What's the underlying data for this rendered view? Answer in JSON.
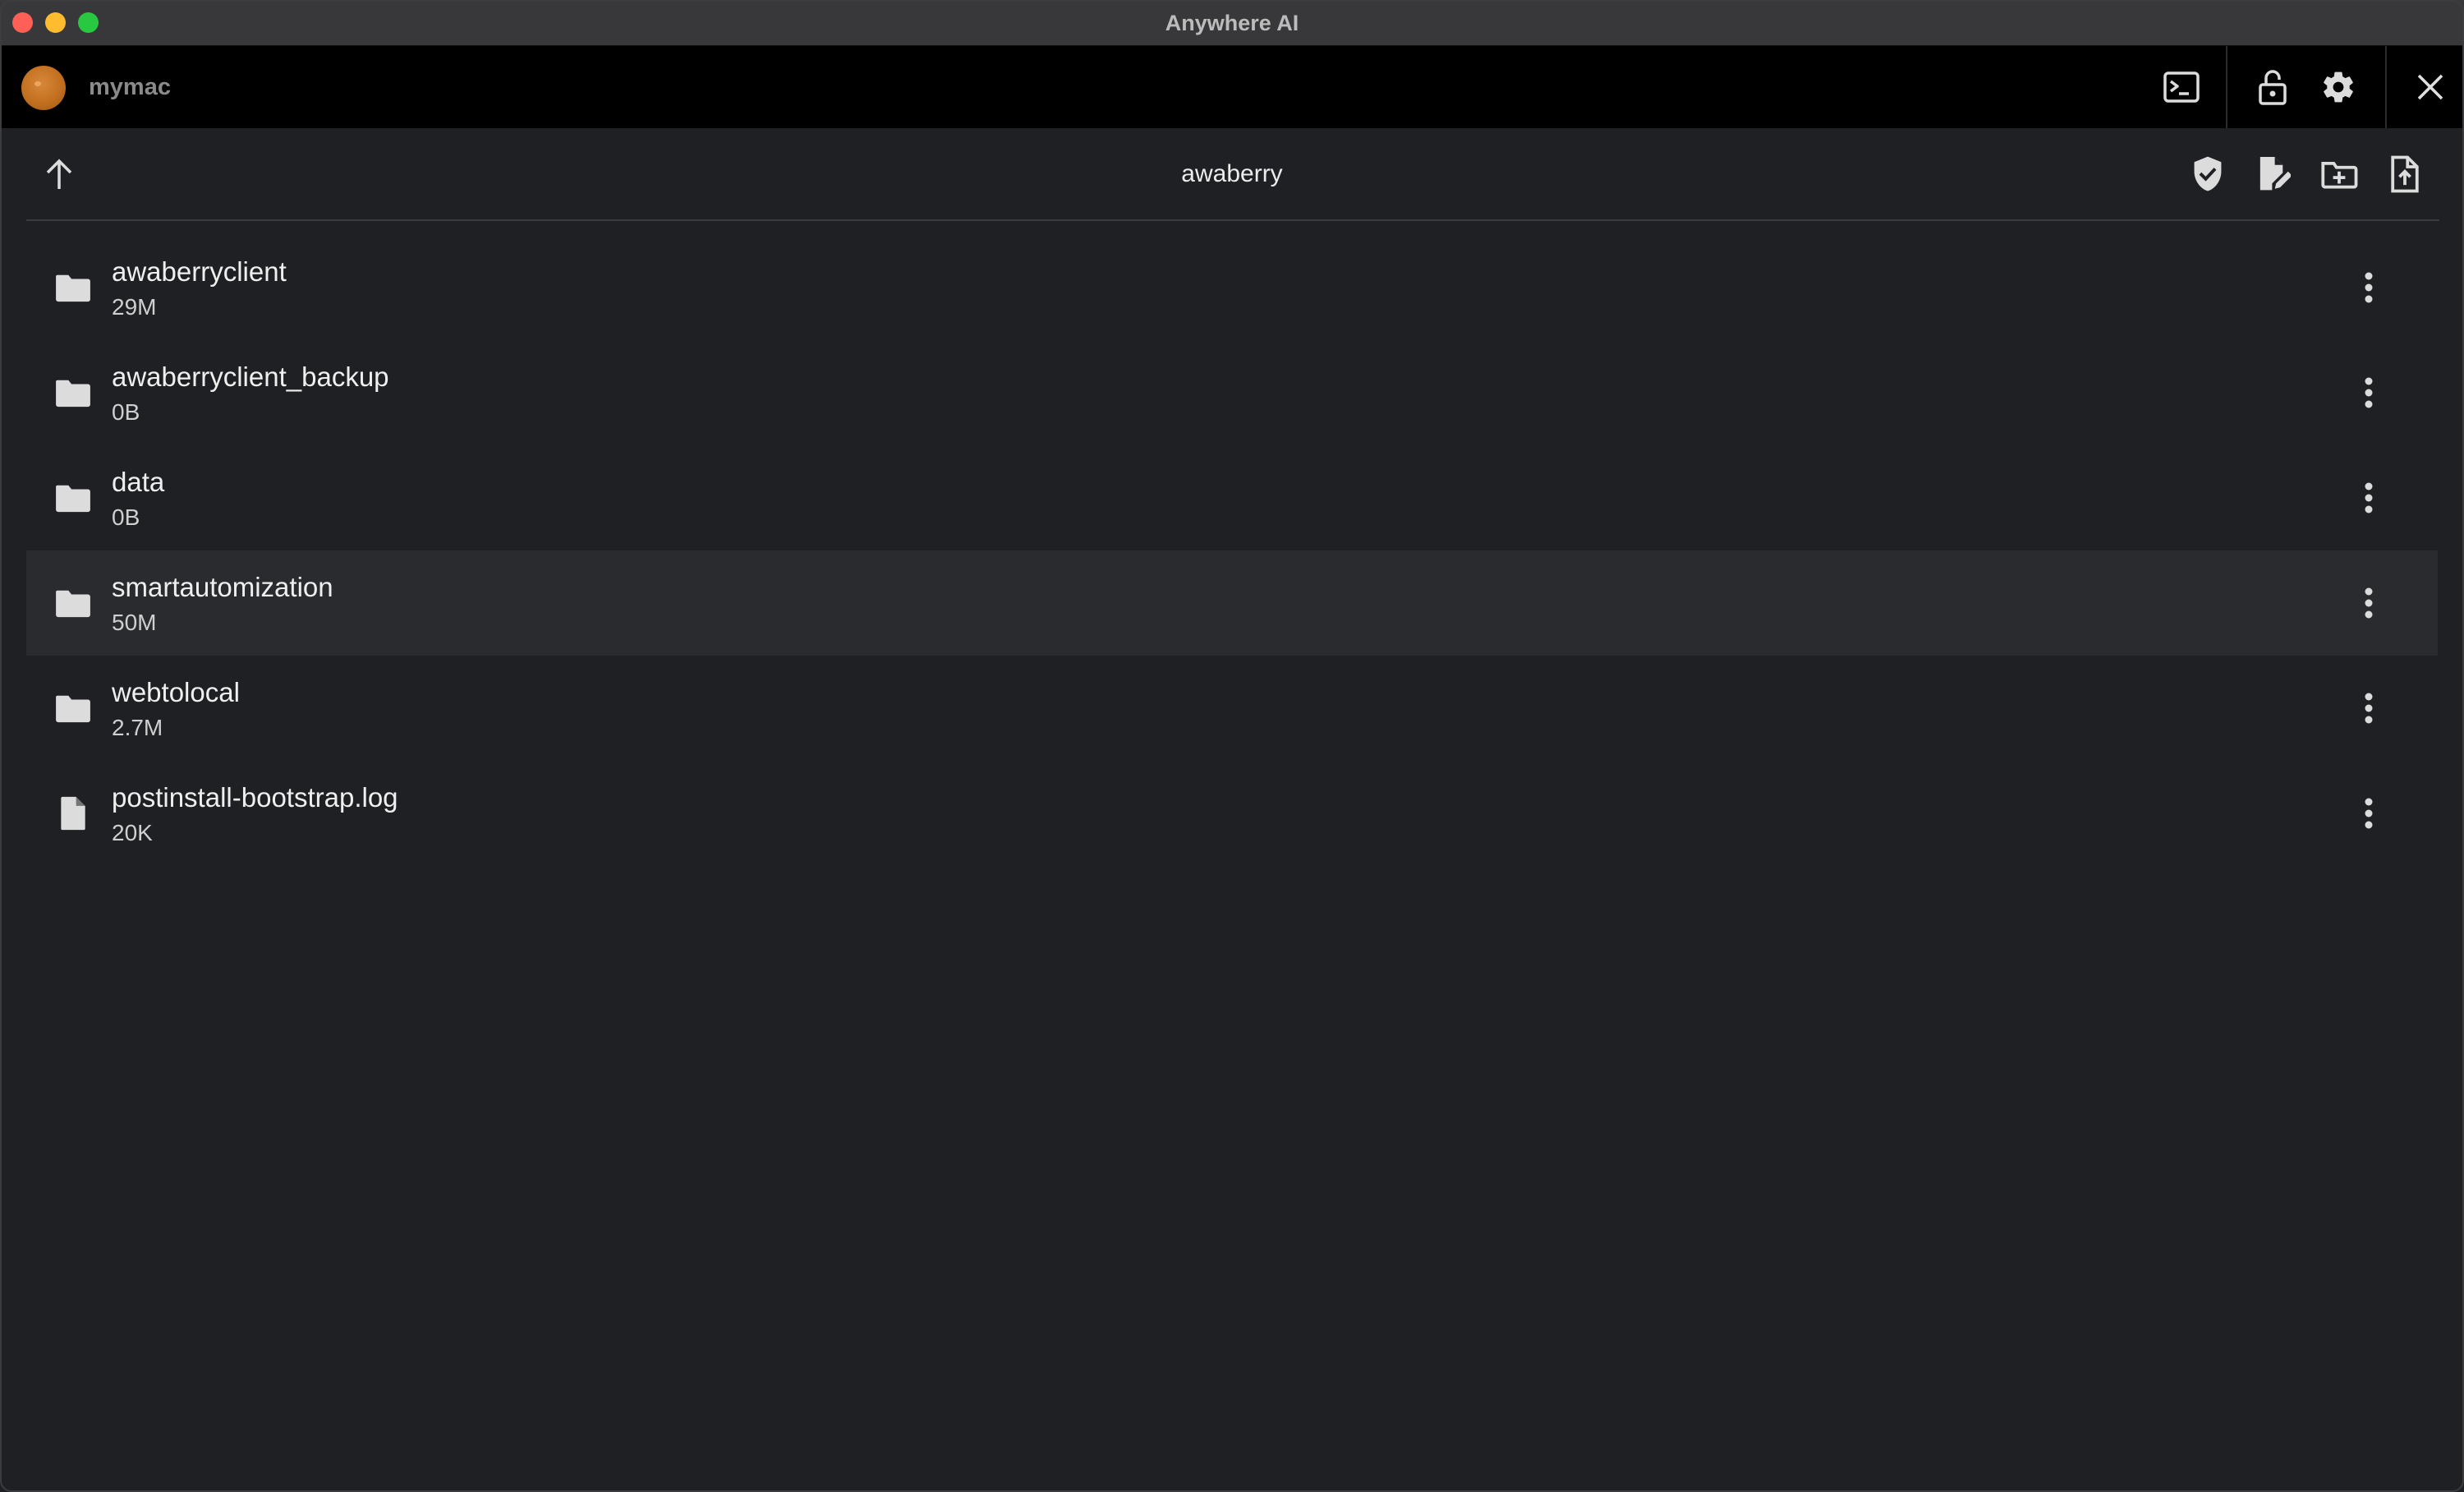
{
  "window": {
    "title": "Anywhere AI"
  },
  "header": {
    "host_name": "mymac",
    "icons": {
      "terminal": "terminal-icon",
      "lock": "lock-open-icon",
      "settings": "gear-icon",
      "close": "close-icon"
    }
  },
  "toolbar": {
    "folder_title": "awaberry",
    "icons": {
      "up": "arrow-up-icon",
      "shield": "shield-check-icon",
      "new_file": "file-edit-icon",
      "new_folder": "folder-plus-icon",
      "upload": "file-upload-icon"
    }
  },
  "files": [
    {
      "name": "awaberryclient",
      "size": "29M",
      "type": "folder"
    },
    {
      "name": "awaberryclient_backup",
      "size": "0B",
      "type": "folder"
    },
    {
      "name": "data",
      "size": "0B",
      "type": "folder"
    },
    {
      "name": "smartautomization",
      "size": "50M",
      "type": "folder",
      "highlighted": true
    },
    {
      "name": "webtolocal",
      "size": "2.7M",
      "type": "folder"
    },
    {
      "name": "postinstall-bootstrap.log",
      "size": "20K",
      "type": "file"
    }
  ],
  "colors": {
    "background": "#1f2023",
    "header_background": "#000000",
    "highlight_row": "#2a2b2e",
    "icon": "#dcdcdc",
    "avatar": "#c2701f"
  }
}
